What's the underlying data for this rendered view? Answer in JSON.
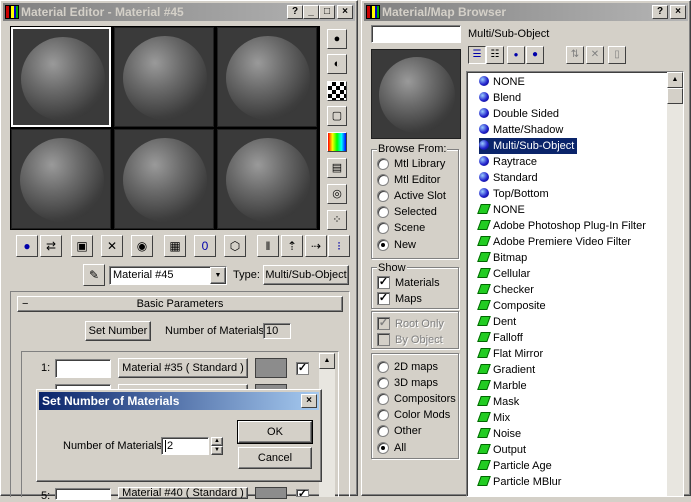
{
  "material_editor": {
    "title": "Material Editor - Material #45",
    "title_buttons": [
      "?",
      "_",
      "□",
      "×"
    ],
    "type_label": "Type:",
    "type_value": "Multi/Sub-Object",
    "material_name": "Material #45",
    "rollout_toggle": "−",
    "rollout_title": "Basic Parameters",
    "set_number_label": "Set Number",
    "number_of_materials_label": "Number of Materials:",
    "number_of_materials_value": "10",
    "sub_rows": [
      {
        "index": "1:",
        "material": "Material #35  ( Standard )",
        "checked": "✓"
      },
      {
        "index": "5:",
        "material": "Material #40  ( Standard )",
        "checked": "✓"
      }
    ]
  },
  "dialog": {
    "title": "Set Number of Materials",
    "close": "×",
    "field_label": "Number of Materials:",
    "field_value": "2",
    "ok_label": "OK",
    "cancel_label": "Cancel"
  },
  "browser": {
    "title": "Material/Map Browser",
    "title_buttons": [
      "?",
      "×"
    ],
    "search_value": "",
    "selected_name": "Multi/Sub-Object",
    "browse_from": {
      "legend": "Browse From:",
      "options": [
        "Mtl Library",
        "Mtl Editor",
        "Active Slot",
        "Selected",
        "Scene",
        "New"
      ],
      "selected": "New"
    },
    "show": {
      "legend": "Show",
      "options": [
        {
          "label": "Materials",
          "checked": "✓"
        },
        {
          "label": "Maps",
          "checked": "✓"
        }
      ],
      "disabled_options": [
        {
          "label": "Root Only",
          "checked": "✓"
        },
        {
          "label": "By Object",
          "checked": ""
        }
      ]
    },
    "map_filter": {
      "options": [
        "2D maps",
        "3D maps",
        "Compositors",
        "Color Mods",
        "Other",
        "All"
      ],
      "selected": "All"
    },
    "items": [
      {
        "name": "NONE",
        "kind": "material"
      },
      {
        "name": "Blend",
        "kind": "material"
      },
      {
        "name": "Double Sided",
        "kind": "material"
      },
      {
        "name": "Matte/Shadow",
        "kind": "material"
      },
      {
        "name": "Multi/Sub-Object",
        "kind": "material"
      },
      {
        "name": "Raytrace",
        "kind": "material"
      },
      {
        "name": "Standard",
        "kind": "material"
      },
      {
        "name": "Top/Bottom",
        "kind": "material"
      },
      {
        "name": "NONE",
        "kind": "map"
      },
      {
        "name": "Adobe Photoshop Plug-In Filter",
        "kind": "map"
      },
      {
        "name": "Adobe Premiere Video Filter",
        "kind": "map"
      },
      {
        "name": "Bitmap",
        "kind": "map"
      },
      {
        "name": "Cellular",
        "kind": "map"
      },
      {
        "name": "Checker",
        "kind": "map"
      },
      {
        "name": "Composite",
        "kind": "map"
      },
      {
        "name": "Dent",
        "kind": "map"
      },
      {
        "name": "Falloff",
        "kind": "map"
      },
      {
        "name": "Flat Mirror",
        "kind": "map"
      },
      {
        "name": "Gradient",
        "kind": "map"
      },
      {
        "name": "Marble",
        "kind": "map"
      },
      {
        "name": "Mask",
        "kind": "map"
      },
      {
        "name": "Mix",
        "kind": "map"
      },
      {
        "name": "Noise",
        "kind": "map"
      },
      {
        "name": "Output",
        "kind": "map"
      },
      {
        "name": "Particle Age",
        "kind": "map"
      },
      {
        "name": "Particle MBlur",
        "kind": "map"
      }
    ],
    "selected_item": "Multi/Sub-Object"
  },
  "icons": {
    "close": "×",
    "scroll_up": "▲",
    "scroll_down": "▼",
    "dropdown": "▼",
    "spin_up": "▲",
    "spin_down": "▼"
  }
}
